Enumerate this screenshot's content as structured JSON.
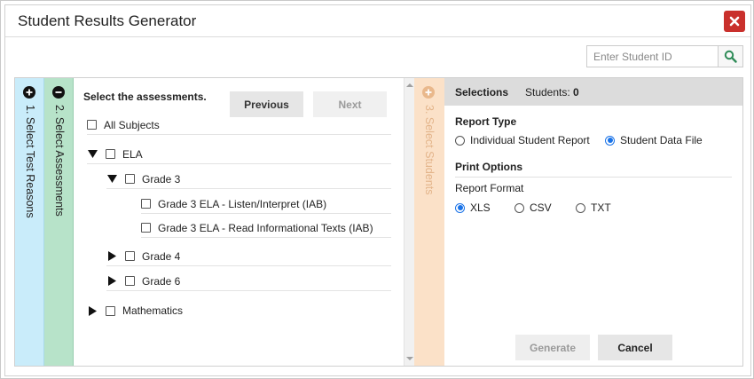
{
  "dialog": {
    "title": "Student Results Generator",
    "close_icon": "close-icon",
    "close_color": "#c9302c"
  },
  "search": {
    "placeholder": "Enter Student ID",
    "icon": "search-icon",
    "icon_color": "#2e8b57"
  },
  "steps": [
    {
      "label": "1. Select Test Reasons",
      "icon": "plus-circle-icon",
      "color": "#c9ecfa"
    },
    {
      "label": "2. Select Assessments",
      "icon": "minus-circle-icon",
      "color": "#b7e3c9"
    },
    {
      "label": "3. Select Students",
      "icon": "plus-circle-icon",
      "color": "#fbe1c8"
    }
  ],
  "assessments": {
    "heading": "Select the assessments.",
    "previous_label": "Previous",
    "next_label": "Next",
    "all_subjects_label": "All Subjects",
    "tree": {
      "ela": "ELA",
      "grade3": "Grade 3",
      "listen": "Grade 3 ELA - Listen/Interpret (IAB)",
      "read": "Grade 3 ELA - Read Informational Texts (IAB)",
      "grade4": "Grade 4",
      "grade6": "Grade 6",
      "math": "Mathematics"
    }
  },
  "selections": {
    "title": "Selections",
    "students_label": "Students:",
    "students_count": "0",
    "report_type_title": "Report Type",
    "report_type_options": [
      "Individual Student Report",
      "Student Data File"
    ],
    "report_type_selected": "Student Data File",
    "print_options_title": "Print Options",
    "report_format_label": "Report Format",
    "format_options": [
      "XLS",
      "CSV",
      "TXT"
    ],
    "format_selected": "XLS",
    "generate_label": "Generate",
    "cancel_label": "Cancel",
    "accent_color": "#1a73e8"
  }
}
